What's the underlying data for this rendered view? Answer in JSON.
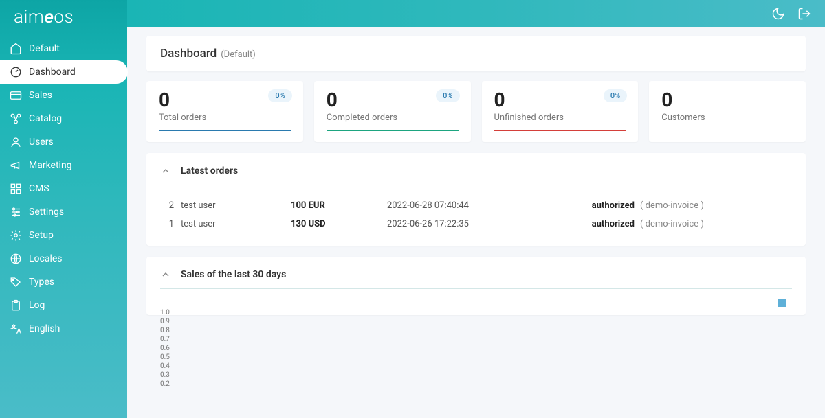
{
  "logo": "aimeos",
  "topbar": {},
  "breadcrumb": {
    "title": "Dashboard",
    "sub": "(Default)"
  },
  "sidebar": {
    "items": [
      {
        "label": "Default",
        "icon": "home"
      },
      {
        "label": "Dashboard",
        "icon": "gauge",
        "active": true
      },
      {
        "label": "Sales",
        "icon": "card"
      },
      {
        "label": "Catalog",
        "icon": "nodes"
      },
      {
        "label": "Users",
        "icon": "user"
      },
      {
        "label": "Marketing",
        "icon": "megaphone"
      },
      {
        "label": "CMS",
        "icon": "grid"
      },
      {
        "label": "Settings",
        "icon": "sliders"
      },
      {
        "label": "Setup",
        "icon": "gear"
      },
      {
        "label": "Locales",
        "icon": "globe"
      },
      {
        "label": "Types",
        "icon": "tag"
      },
      {
        "label": "Log",
        "icon": "clipboard"
      },
      {
        "label": "English",
        "icon": "language"
      }
    ]
  },
  "stats": [
    {
      "value": "0",
      "label": "Total orders",
      "badge": "0%",
      "bar": "blue"
    },
    {
      "value": "0",
      "label": "Completed orders",
      "badge": "0%",
      "bar": "green"
    },
    {
      "value": "0",
      "label": "Unfinished orders",
      "badge": "0%",
      "bar": "red"
    },
    {
      "value": "0",
      "label": "Customers",
      "badge": "",
      "bar": "none"
    }
  ],
  "latest_orders": {
    "title": "Latest orders",
    "rows": [
      {
        "id": "2",
        "user": "test user",
        "amount": "100 EUR",
        "date": "2022-06-28 07:40:44",
        "status": "authorized",
        "invoice": "( demo-invoice )"
      },
      {
        "id": "1",
        "user": "test user",
        "amount": "130 USD",
        "date": "2022-06-26 17:22:35",
        "status": "authorized",
        "invoice": "( demo-invoice )"
      }
    ]
  },
  "sales_panel": {
    "title": "Sales of the last 30 days"
  },
  "chart_data": {
    "type": "line",
    "title": "Sales of the last 30 days",
    "y_ticks": [
      "1.0",
      "0.9",
      "0.8",
      "0.7",
      "0.6",
      "0.5",
      "0.4",
      "0.3",
      "0.2"
    ],
    "ylim": [
      0,
      1.0
    ],
    "series": [
      {
        "name": "",
        "values": []
      }
    ],
    "legend_color": "#5fb0d8"
  }
}
